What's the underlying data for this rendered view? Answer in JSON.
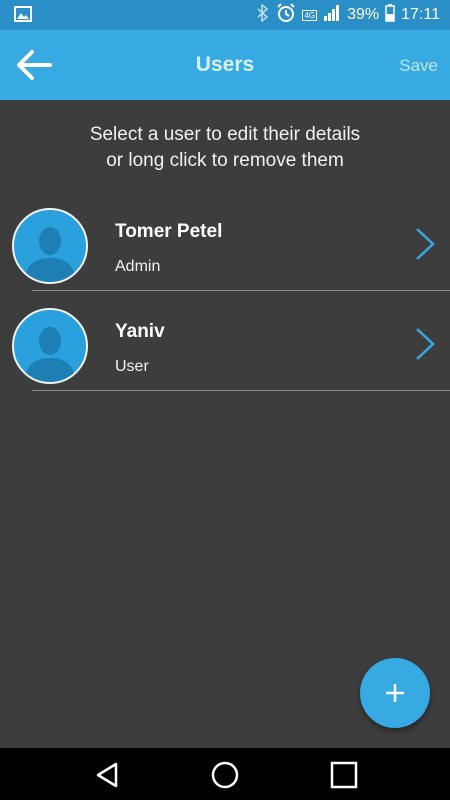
{
  "status_bar": {
    "battery_percent": "39%",
    "time": "17:11",
    "network": "4G",
    "icons": [
      "image-icon",
      "bluetooth-icon",
      "alarm-icon",
      "signal-icon",
      "battery-icon"
    ]
  },
  "app_bar": {
    "title": "Users",
    "save_label": "Save",
    "back_icon": "back-arrow-icon"
  },
  "instructions": {
    "line1": "Select a user to edit their details",
    "line2": "or long click to remove them"
  },
  "users": [
    {
      "name": "Tomer Petel",
      "role": "Admin"
    },
    {
      "name": "Yaniv",
      "role": "User"
    }
  ],
  "fab": {
    "icon": "plus-icon"
  },
  "nav_bar": {
    "icons": [
      "back-triangle-icon",
      "home-circle-icon",
      "recents-square-icon"
    ]
  },
  "colors": {
    "accent": "#37a9e3",
    "status_bar": "#2a8fc7",
    "background": "#3d3d3d"
  }
}
